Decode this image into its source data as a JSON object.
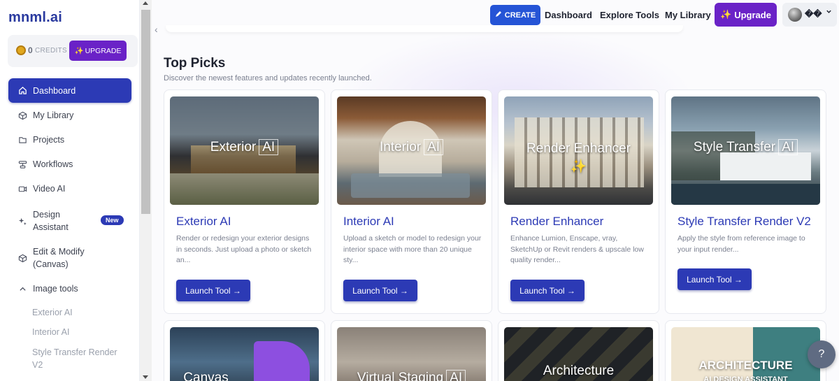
{
  "brand": {
    "logo": "mnml.ai"
  },
  "credits": {
    "count": "0",
    "label": "CREDITS",
    "upgrade_label": "UPGRADE",
    "upgrade_icon": "sparkle-icon"
  },
  "sidebar": {
    "items": [
      {
        "label": "Dashboard",
        "icon": "home-icon",
        "active": true
      },
      {
        "label": "My Library",
        "icon": "cube-icon"
      },
      {
        "label": "Projects",
        "icon": "folder-icon"
      },
      {
        "label": "Workflows",
        "icon": "workflow-icon"
      },
      {
        "label": "Video AI",
        "icon": "video-icon"
      },
      {
        "label": "Design Assistant",
        "icon": "sparkles-icon",
        "badge": "New"
      },
      {
        "label": "Edit & Modify (Canvas)",
        "icon": "box-icon"
      },
      {
        "label": "Image tools",
        "icon": "chevron-up-icon"
      }
    ],
    "sub_items": [
      "Exterior AI",
      "Interior AI",
      "Style Transfer Render V2"
    ]
  },
  "header": {
    "create_label": "CREATE",
    "links": [
      "Dashboard",
      "Explore Tools",
      "My Library"
    ],
    "upgrade_label": "Upgrade",
    "user_name": "��"
  },
  "section": {
    "title": "Top Picks",
    "subtitle": "Discover the newest features and updates recently launched."
  },
  "cards": [
    {
      "thumb_title": "Exterior",
      "thumb_ai": "AI",
      "title": "Exterior AI",
      "desc": "Render or redesign your exterior designs in seconds. Just upload a photo or sketch an...",
      "button": "Launch Tool →"
    },
    {
      "thumb_title": "Interior",
      "thumb_ai": "AI",
      "title": "Interior AI",
      "desc": "Upload a sketch or model to redesign your interior space with more than 20 unique sty...",
      "button": "Launch Tool →"
    },
    {
      "thumb_title": "Render Enhancer",
      "thumb_ai": "✨",
      "title": "Render Enhancer",
      "desc": "Enhance Lumion, Enscape, vray, SketchUp or Revit renders & upscale low quality render...",
      "button": "Launch Tool →"
    },
    {
      "thumb_title": "Style Transfer",
      "thumb_ai": "AI",
      "title": "Style Transfer Render V2",
      "desc": "Apply the style from reference image to your input render...",
      "button": "Launch Tool →"
    }
  ],
  "cards_row2": [
    {
      "thumb_title": "Canvas"
    },
    {
      "thumb_title": "Virtual Staging",
      "thumb_ai": "AI"
    },
    {
      "thumb_title": "Architecture"
    },
    {
      "thumb_title": "ARCHITECTURE",
      "thumb_sub": "AI DESIGN ASSISTANT"
    }
  ],
  "help": {
    "label": "?"
  }
}
